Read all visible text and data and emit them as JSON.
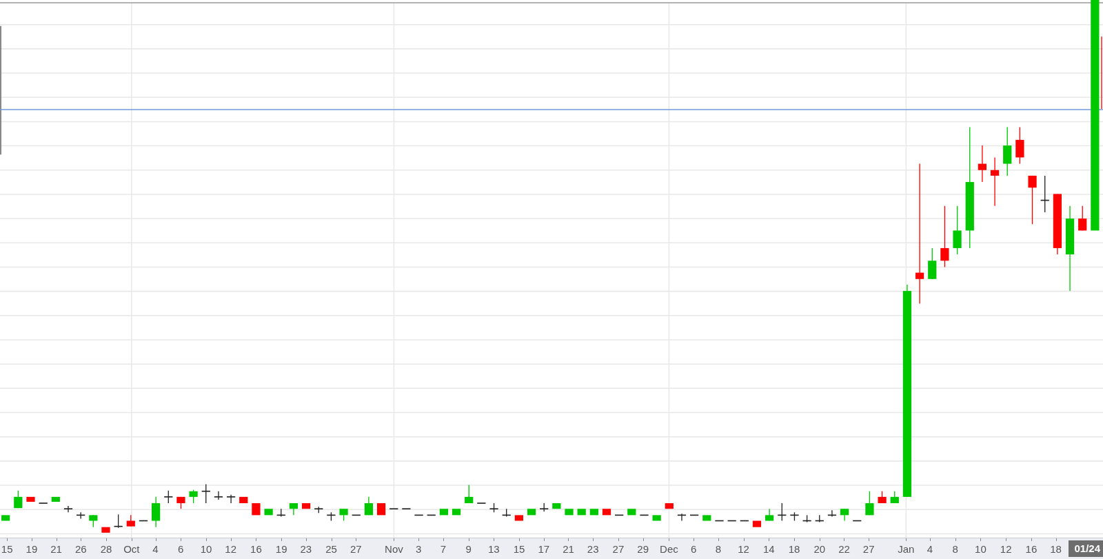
{
  "x_axis": {
    "labels": [
      "15",
      "19",
      "21",
      "26",
      "28",
      "Oct",
      "4",
      "6",
      "10",
      "12",
      "16",
      "19",
      "23",
      "25",
      "27",
      "Nov",
      "3",
      "7",
      "9",
      "13",
      "15",
      "17",
      "21",
      "23",
      "27",
      "29",
      "Dec",
      "6",
      "8",
      "12",
      "14",
      "18",
      "20",
      "22",
      "27",
      "Jan",
      "4",
      "8",
      "10",
      "12",
      "16",
      "18"
    ]
  },
  "cursor_date_badge": "01/24"
}
